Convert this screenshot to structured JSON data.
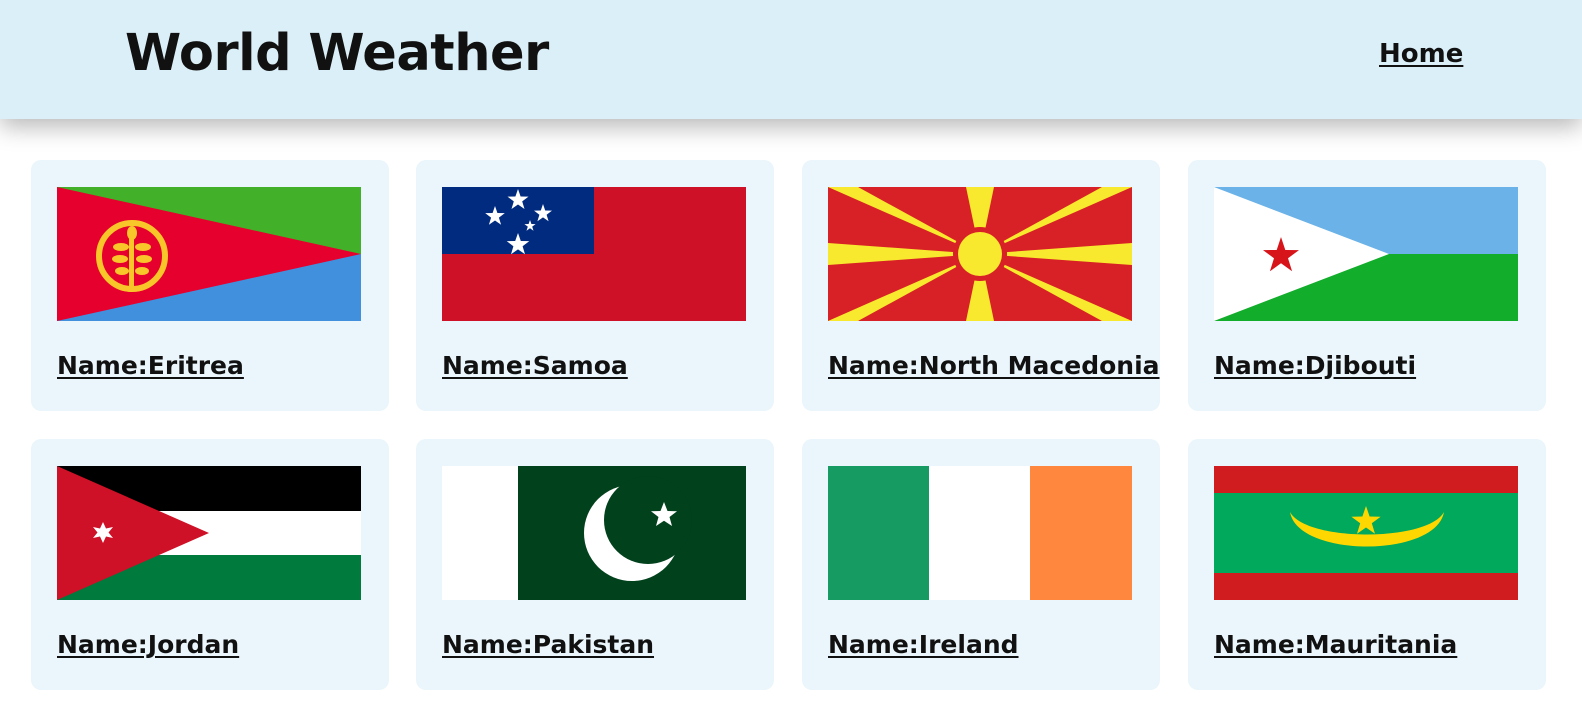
{
  "header": {
    "title": "World Weather",
    "nav_home": "Home"
  },
  "countries": [
    {
      "label": "Name:Eritrea"
    },
    {
      "label": "Name:Samoa"
    },
    {
      "label": "Name:North Macedonia"
    },
    {
      "label": "Name:Djibouti"
    },
    {
      "label": "Name:Jordan"
    },
    {
      "label": "Name:Pakistan"
    },
    {
      "label": "Name:Ireland"
    },
    {
      "label": "Name:Mauritania"
    }
  ],
  "colors": {
    "header_bg": "#dbeff8",
    "card_bg": "#eaf6fc",
    "text": "#111111"
  }
}
